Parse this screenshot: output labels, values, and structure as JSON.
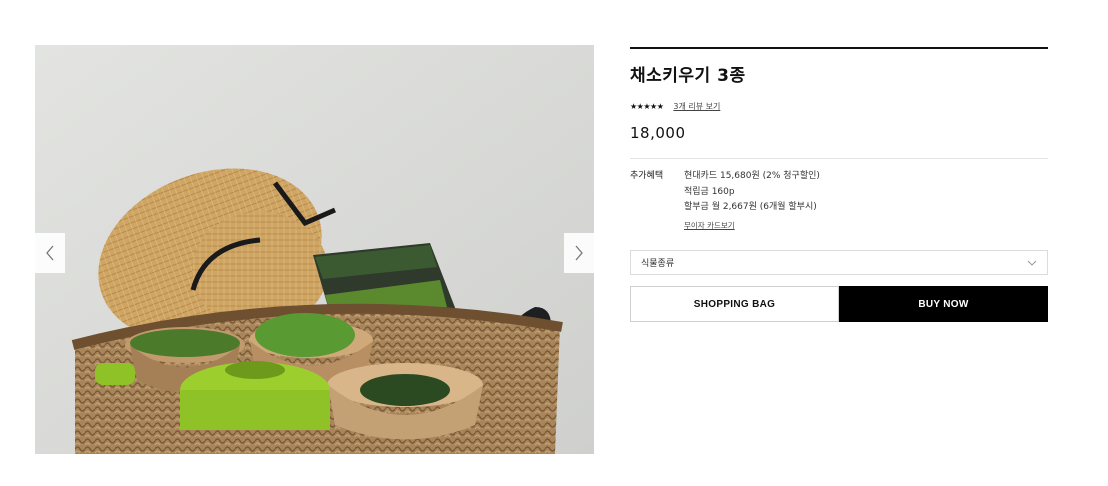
{
  "product": {
    "title": "채소키우기 3종",
    "rating_stars": "★★★★★",
    "review_link": "3개 리뷰 보기",
    "price": "18,000"
  },
  "benefits": {
    "label": "추가혜택",
    "lines": [
      "현대카드 15,680원 (2% 청구할인)",
      "적립금 160p",
      "할부금 월 2,667원 (6개월 할부시)"
    ],
    "card_link": "무이자 카드보기"
  },
  "option_select": {
    "value": "식물종류"
  },
  "buttons": {
    "shopping_bag": "SHOPPING BAG",
    "buy_now": "BUY NOW"
  },
  "gallery": {
    "prev_icon": "chevron-left-icon",
    "next_icon": "chevron-right-icon",
    "image_subject": "basket-with-hat-and-vegetable-pots"
  }
}
